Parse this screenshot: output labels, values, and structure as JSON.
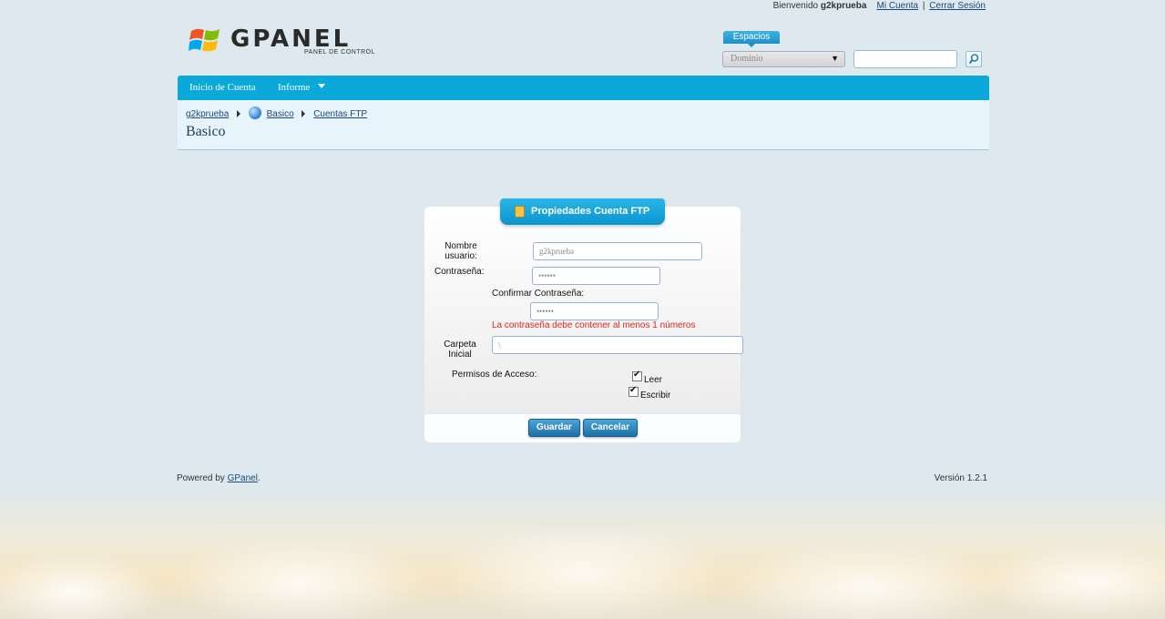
{
  "topbar": {
    "welcome_prefix": "Bienvenido",
    "username": "g2kprueba",
    "my_account": "Mi Cuenta",
    "separator": "|",
    "logout": "Cerrar Sesión"
  },
  "logo": {
    "wordmark": "GPANEL",
    "tagline": "PANEL DE CONTROL"
  },
  "spaces": {
    "tab_label": "Espacios",
    "domain_select_value": "Dominio",
    "search_value": ""
  },
  "nav": {
    "items": [
      {
        "label": "Inicio de Cuenta"
      },
      {
        "label": "Informe"
      }
    ]
  },
  "breadcrumb": {
    "items": [
      "g2kprueba",
      "Basico",
      "Cuentas FTP"
    ]
  },
  "page_title": "Basico",
  "panel": {
    "title": "Propiedades Cuenta FTP",
    "username_label_line1": "Nombre",
    "username_label_line2": "usuario:",
    "username_value": "g2kprueba",
    "password_label": "Contraseña:",
    "password_value": "••••••",
    "confirm_label": "Confirmar Contraseña:",
    "confirm_value": "••••••",
    "error_message": "La contraseña debe contener al menos 1 números",
    "folder_label_line1": "Carpeta",
    "folder_label_line2": "Inicial",
    "folder_value": "\\",
    "permissions_label": "Permisos de Acceso:",
    "perm_read": "Leer",
    "perm_write": "Escribir",
    "save_button": "Guardar",
    "cancel_button": "Cancelar"
  },
  "footer": {
    "powered_prefix": "Powered by",
    "powered_link": "GPanel",
    "powered_suffix": ".",
    "version": "Versión 1.2.1"
  }
}
